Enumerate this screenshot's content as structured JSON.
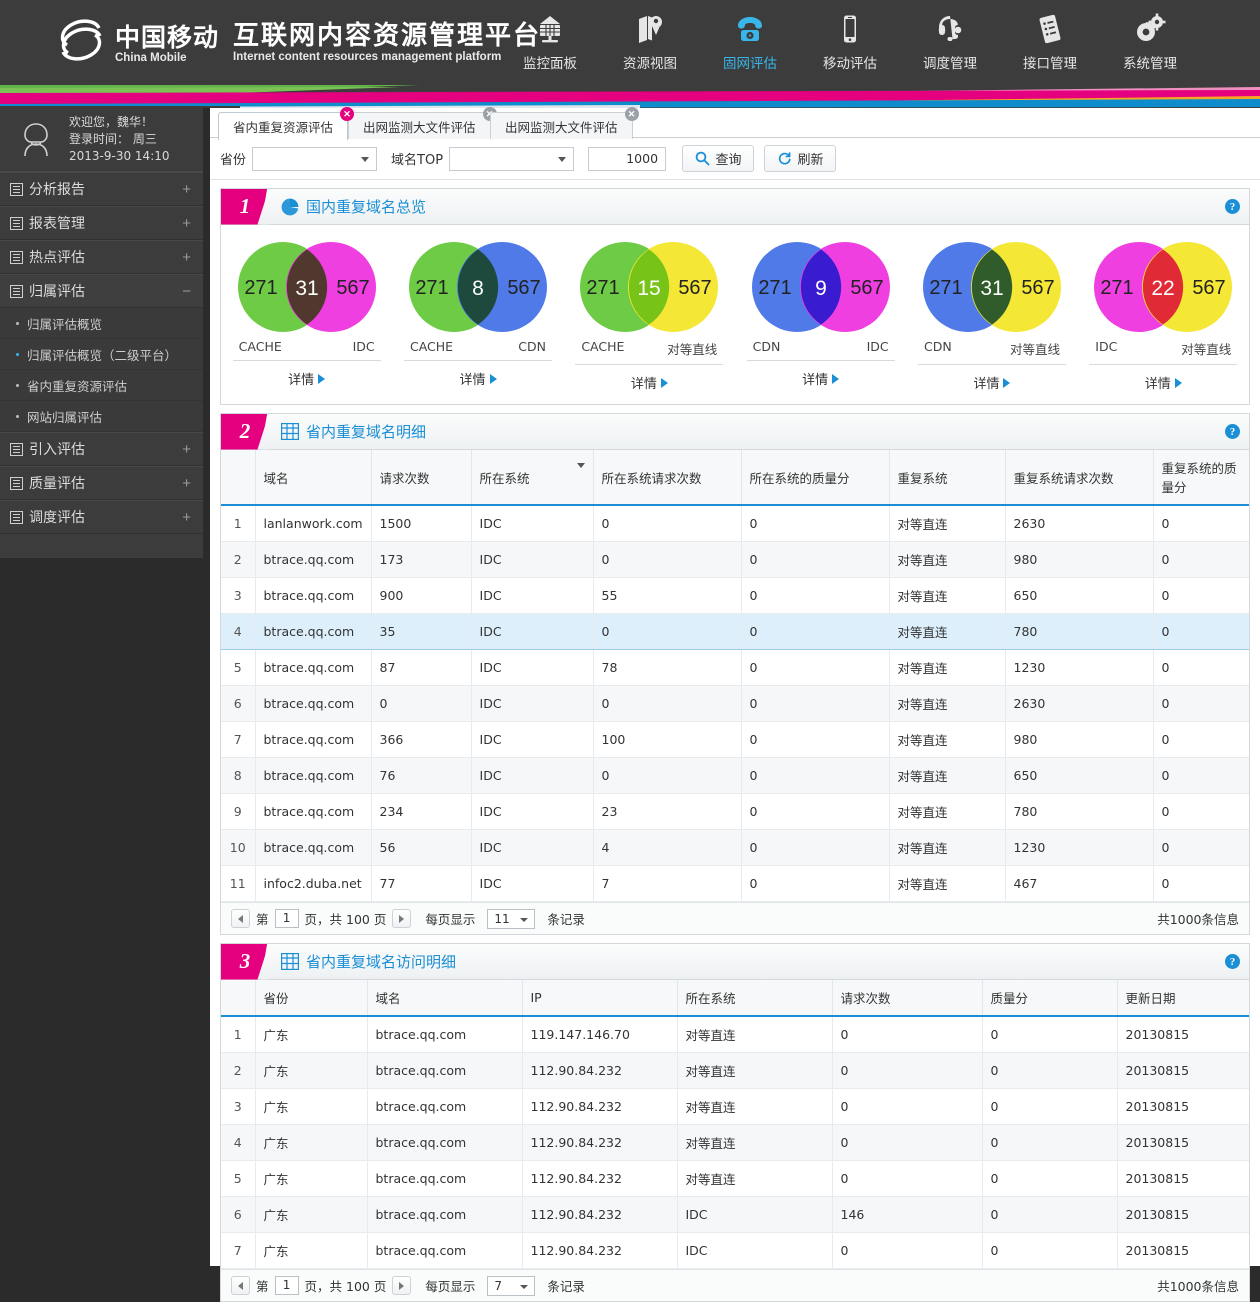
{
  "header": {
    "brand_cn": "中国移动",
    "brand_en": "China Mobile",
    "platform_cn": "互联网内容资源管理平台",
    "platform_en": "Internet content resources management platform",
    "accent_blue": "#39b5ea",
    "accent_pink": "#e4007f",
    "nav": [
      {
        "label": "监控面板",
        "icon": "dashboard-icon",
        "active": false
      },
      {
        "label": "资源视图",
        "icon": "map-pin-icon",
        "active": false
      },
      {
        "label": "固网评估",
        "icon": "telephone-icon",
        "active": true
      },
      {
        "label": "移动评估",
        "icon": "mobile-phone-icon",
        "active": false
      },
      {
        "label": "调度管理",
        "icon": "headset-icon",
        "active": false
      },
      {
        "label": "接口管理",
        "icon": "document-list-icon",
        "active": false
      },
      {
        "label": "系统管理",
        "icon": "gears-icon",
        "active": false
      }
    ]
  },
  "sidebar": {
    "welcome": "欢迎您，魏华！",
    "login_label": "登录时间： 周三",
    "login_time": "2013-9-30  14:10",
    "groups": [
      {
        "label": "分析报告",
        "expander": "+",
        "open": false
      },
      {
        "label": "报表管理",
        "expander": "+",
        "open": false
      },
      {
        "label": "热点评估",
        "expander": "+",
        "open": false
      },
      {
        "label": "归属评估",
        "expander": "−",
        "open": true,
        "items": [
          {
            "label": "归属评估概览",
            "active": false
          },
          {
            "label": "归属评估概览（二级平台）",
            "active": true
          },
          {
            "label": "省内重复资源评估",
            "active": false
          },
          {
            "label": "网站归属评估",
            "active": false
          }
        ]
      },
      {
        "label": "引入评估",
        "expander": "+",
        "open": false
      },
      {
        "label": "质量评估",
        "expander": "+",
        "open": false
      },
      {
        "label": "调度评估",
        "expander": "+",
        "open": false
      }
    ]
  },
  "tabs": [
    {
      "label": "省内重复资源评估",
      "active": true
    },
    {
      "label": "出网监测大文件评估",
      "active": false
    },
    {
      "label": "出网监测大文件评估",
      "active": false
    }
  ],
  "filter": {
    "province_label": "省份",
    "province_value": "",
    "domain_top_label": "域名TOP",
    "domain_top_value": "",
    "top_count": "1000",
    "query_button": "查询",
    "refresh_button": "刷新"
  },
  "panel1": {
    "number": "1",
    "title": "国内重复域名总览",
    "help": "?",
    "detail_label": "详情"
  },
  "chart_data": {
    "type": "venn",
    "title": "国内重复域名总览",
    "diagrams": [
      {
        "left_label": "CACHE",
        "right_label": "IDC",
        "left_value": 271,
        "right_value": 567,
        "overlap_value": 31,
        "left_color": "#6dcb45",
        "right_color": "#ef3fe0",
        "overlap_color": "#50382e"
      },
      {
        "left_label": "CACHE",
        "right_label": "CDN",
        "left_value": 271,
        "right_value": 567,
        "overlap_value": 8,
        "left_color": "#6dcb45",
        "right_color": "#4f7ae8",
        "overlap_color": "#1d4a3c"
      },
      {
        "left_label": "CACHE",
        "right_label": "对等直线",
        "left_value": 271,
        "right_value": 567,
        "overlap_value": 15,
        "left_color": "#6dcb45",
        "right_color": "#f4e735",
        "overlap_color": "#77c318"
      },
      {
        "left_label": "CDN",
        "right_label": "IDC",
        "left_value": 271,
        "right_value": 567,
        "overlap_value": 9,
        "left_color": "#4f7ae8",
        "right_color": "#ef3fe0",
        "overlap_color": "#3a1cd0"
      },
      {
        "left_label": "CDN",
        "right_label": "对等直线",
        "left_value": 271,
        "right_value": 567,
        "overlap_value": 31,
        "left_color": "#4f7ae8",
        "right_color": "#f4e735",
        "overlap_color": "#2f5c2a"
      },
      {
        "left_label": "IDC",
        "right_label": "对等直线",
        "left_value": 271,
        "right_value": 567,
        "overlap_value": 22,
        "left_color": "#ef3fe0",
        "right_color": "#f4e735",
        "overlap_color": "#e02b36"
      }
    ]
  },
  "panel2": {
    "number": "2",
    "title": "省内重复域名明细",
    "help": "?",
    "columns": [
      "",
      "域名",
      "请求次数",
      "所在系统",
      "所在系统请求次数",
      "所在系统的质量分",
      "重复系统",
      "重复系统请求次数",
      "重复系统的质量分"
    ],
    "sorted_column_index": 3,
    "rows": [
      {
        "n": "1",
        "domain": "lanlanwork.com",
        "requests": "1500",
        "system": "IDC",
        "sys_requests": "0",
        "sys_quality": "0",
        "dup_system": "对等直连",
        "dup_requests": "2630",
        "dup_quality": "0",
        "selected": false
      },
      {
        "n": "2",
        "domain": "btrace.qq.com",
        "requests": "173",
        "system": "IDC",
        "sys_requests": "0",
        "sys_quality": "0",
        "dup_system": "对等直连",
        "dup_requests": "980",
        "dup_quality": "0",
        "selected": false
      },
      {
        "n": "3",
        "domain": "btrace.qq.com",
        "requests": "900",
        "system": "IDC",
        "sys_requests": "55",
        "sys_quality": "0",
        "dup_system": "对等直连",
        "dup_requests": "650",
        "dup_quality": "0",
        "selected": false
      },
      {
        "n": "4",
        "domain": "btrace.qq.com",
        "requests": "35",
        "system": "IDC",
        "sys_requests": "0",
        "sys_quality": "0",
        "dup_system": "对等直连",
        "dup_requests": "780",
        "dup_quality": "0",
        "selected": true
      },
      {
        "n": "5",
        "domain": "btrace.qq.com",
        "requests": "87",
        "system": "IDC",
        "sys_requests": "78",
        "sys_quality": "0",
        "dup_system": "对等直连",
        "dup_requests": "1230",
        "dup_quality": "0",
        "selected": false
      },
      {
        "n": "6",
        "domain": "btrace.qq.com",
        "requests": "0",
        "system": "IDC",
        "sys_requests": "0",
        "sys_quality": "0",
        "dup_system": "对等直连",
        "dup_requests": "2630",
        "dup_quality": "0",
        "selected": false
      },
      {
        "n": "7",
        "domain": "btrace.qq.com",
        "requests": "366",
        "system": "IDC",
        "sys_requests": "100",
        "sys_quality": "0",
        "dup_system": "对等直连",
        "dup_requests": "980",
        "dup_quality": "0",
        "selected": false
      },
      {
        "n": "8",
        "domain": "btrace.qq.com",
        "requests": "76",
        "system": "IDC",
        "sys_requests": "0",
        "sys_quality": "0",
        "dup_system": "对等直连",
        "dup_requests": "650",
        "dup_quality": "0",
        "selected": false
      },
      {
        "n": "9",
        "domain": "btrace.qq.com",
        "requests": "234",
        "system": "IDC",
        "sys_requests": "23",
        "sys_quality": "0",
        "dup_system": "对等直连",
        "dup_requests": "780",
        "dup_quality": "0",
        "selected": false
      },
      {
        "n": "10",
        "domain": "btrace.qq.com",
        "requests": "56",
        "system": "IDC",
        "sys_requests": "4",
        "sys_quality": "0",
        "dup_system": "对等直连",
        "dup_requests": "1230",
        "dup_quality": "0",
        "selected": false
      },
      {
        "n": "11",
        "domain": "infoc2.duba.net",
        "requests": "77",
        "system": "IDC",
        "sys_requests": "7",
        "sys_quality": "0",
        "dup_system": "对等直连",
        "dup_requests": "467",
        "dup_quality": "0",
        "selected": false
      }
    ],
    "pager": {
      "prefix": "第",
      "page": "1",
      "middle": "页，共 100 页",
      "per_page_label": "每页显示",
      "per_page": "11",
      "records_label": "条记录",
      "total": "共1000条信息"
    }
  },
  "panel3": {
    "number": "3",
    "title": "省内重复域名访问明细",
    "help": "?",
    "columns": [
      "",
      "省份",
      "域名",
      "IP",
      "所在系统",
      "请求次数",
      "质量分",
      "更新日期"
    ],
    "rows": [
      {
        "n": "1",
        "province": "广东",
        "domain": "btrace.qq.com",
        "ip": "119.147.146.70",
        "system": "对等直连",
        "requests": "0",
        "quality": "0",
        "update": "20130815"
      },
      {
        "n": "2",
        "province": "广东",
        "domain": "btrace.qq.com",
        "ip": "112.90.84.232",
        "system": "对等直连",
        "requests": "0",
        "quality": "0",
        "update": "20130815"
      },
      {
        "n": "3",
        "province": "广东",
        "domain": "btrace.qq.com",
        "ip": "112.90.84.232",
        "system": "对等直连",
        "requests": "0",
        "quality": "0",
        "update": "20130815"
      },
      {
        "n": "4",
        "province": "广东",
        "domain": "btrace.qq.com",
        "ip": "112.90.84.232",
        "system": "对等直连",
        "requests": "0",
        "quality": "0",
        "update": "20130815"
      },
      {
        "n": "5",
        "province": "广东",
        "domain": "btrace.qq.com",
        "ip": "112.90.84.232",
        "system": "对等直连",
        "requests": "0",
        "quality": "0",
        "update": "20130815"
      },
      {
        "n": "6",
        "province": "广东",
        "domain": "btrace.qq.com",
        "ip": "112.90.84.232",
        "system": "IDC",
        "requests": "146",
        "quality": "0",
        "update": "20130815"
      },
      {
        "n": "7",
        "province": "广东",
        "domain": "btrace.qq.com",
        "ip": "112.90.84.232",
        "system": "IDC",
        "requests": "0",
        "quality": "0",
        "update": "20130815"
      }
    ],
    "pager": {
      "prefix": "第",
      "page": "1",
      "middle": "页，共 100 页",
      "per_page_label": "每页显示",
      "per_page": "7",
      "records_label": "条记录",
      "total": "共1000条信息"
    }
  }
}
